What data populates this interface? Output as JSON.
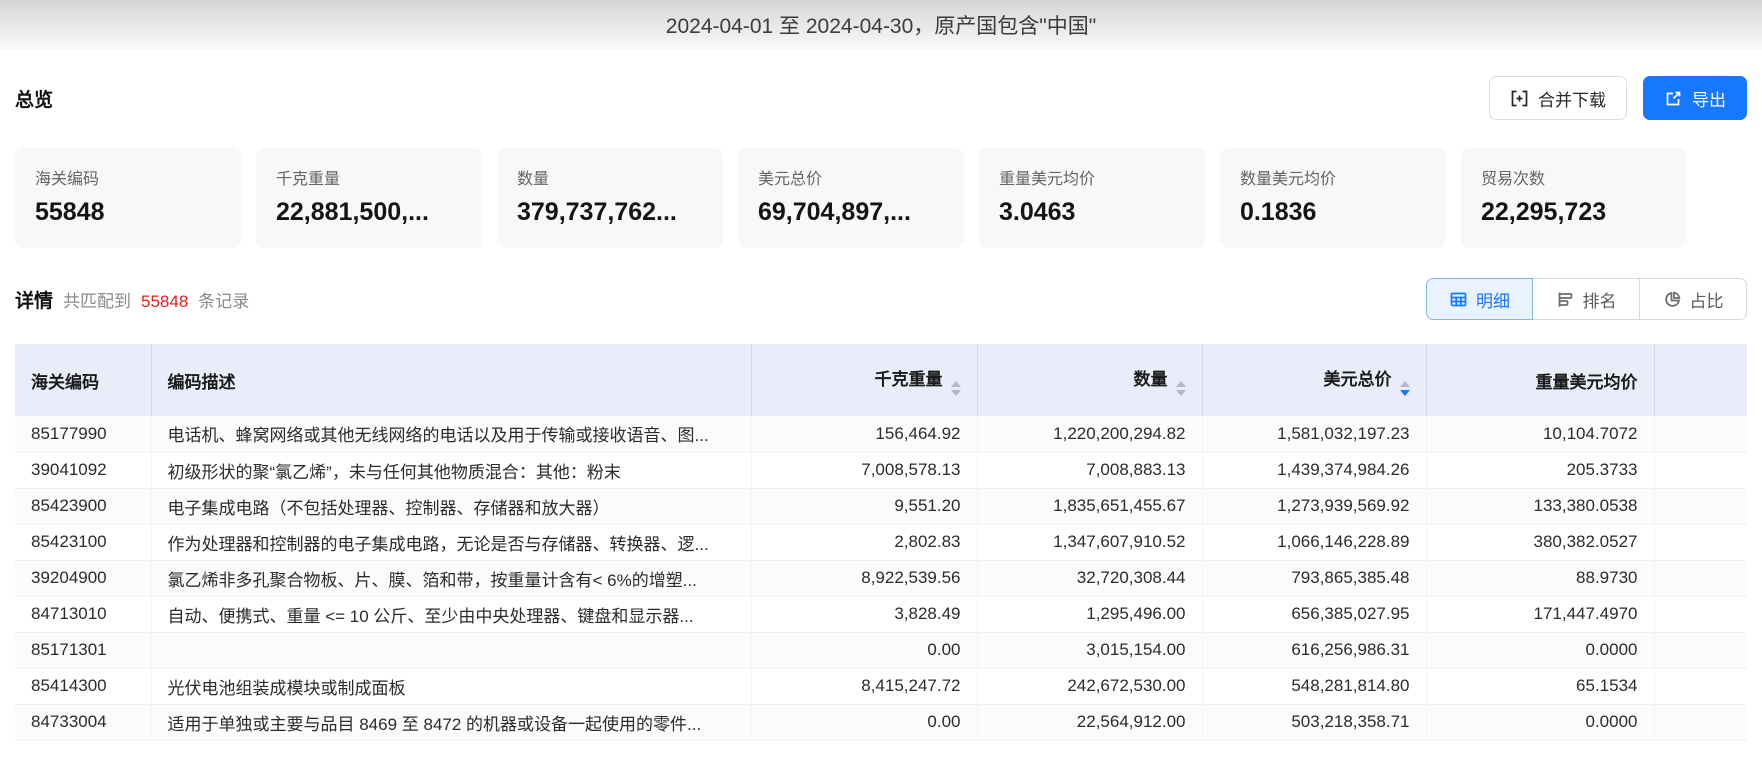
{
  "banner": {
    "title": "2024-04-01 至 2024-04-30，原产国包含\"中国\""
  },
  "overview": {
    "title": "总览",
    "merge_download_label": "合并下载",
    "export_label": "导出",
    "cards": [
      {
        "label": "海关编码",
        "value": "55848"
      },
      {
        "label": "千克重量",
        "value": "22,881,500,..."
      },
      {
        "label": "数量",
        "value": "379,737,762..."
      },
      {
        "label": "美元总价",
        "value": "69,704,897,..."
      },
      {
        "label": "重量美元均价",
        "value": "3.0463"
      },
      {
        "label": "数量美元均价",
        "value": "0.1836"
      },
      {
        "label": "贸易次数",
        "value": "22,295,723"
      }
    ]
  },
  "details": {
    "title": "详情",
    "match_prefix": "共匹配到",
    "record_count": "55848",
    "match_suffix": "条记录",
    "tabs": [
      {
        "label": "明细",
        "icon": "table-icon",
        "active": true
      },
      {
        "label": "排名",
        "icon": "ranking-icon",
        "active": false
      },
      {
        "label": "占比",
        "icon": "pie-icon",
        "active": false
      }
    ]
  },
  "table": {
    "columns": [
      {
        "label": "海关编码",
        "sortable": false,
        "sort": "none",
        "align": "left"
      },
      {
        "label": "编码描述",
        "sortable": false,
        "sort": "none",
        "align": "left"
      },
      {
        "label": "千克重量",
        "sortable": true,
        "sort": "none",
        "align": "right"
      },
      {
        "label": "数量",
        "sortable": true,
        "sort": "none",
        "align": "right"
      },
      {
        "label": "美元总价",
        "sortable": true,
        "sort": "desc",
        "align": "right"
      },
      {
        "label": "重量美元均价",
        "sortable": false,
        "sort": "none",
        "align": "right"
      }
    ],
    "rows": [
      [
        "85177990",
        "电话机、蜂窝网络或其他无线网络的电话以及用于传输或接收语音、图...",
        "156,464.92",
        "1,220,200,294.82",
        "1,581,032,197.23",
        "10,104.7072"
      ],
      [
        "39041092",
        "初级形状的聚“氯乙烯”，未与任何其他物质混合：其他：粉末",
        "7,008,578.13",
        "7,008,883.13",
        "1,439,374,984.26",
        "205.3733"
      ],
      [
        "85423900",
        "电子集成电路（不包括处理器、控制器、存储器和放大器）",
        "9,551.20",
        "1,835,651,455.67",
        "1,273,939,569.92",
        "133,380.0538"
      ],
      [
        "85423100",
        "作为处理器和控制器的电子集成电路，无论是否与存储器、转换器、逻...",
        "2,802.83",
        "1,347,607,910.52",
        "1,066,146,228.89",
        "380,382.0527"
      ],
      [
        "39204900",
        "氯乙烯非多孔聚合物板、片、膜、箔和带，按重量计含有< 6%的增塑...",
        "8,922,539.56",
        "32,720,308.44",
        "793,865,385.48",
        "88.9730"
      ],
      [
        "84713010",
        "自动、便携式、重量 <= 10 公斤、至少由中央处理器、键盘和显示器...",
        "3,828.49",
        "1,295,496.00",
        "656,385,027.95",
        "171,447.4970"
      ],
      [
        "85171301",
        "",
        "0.00",
        "3,015,154.00",
        "616,256,986.31",
        "0.0000"
      ],
      [
        "85414300",
        "光伏电池组装成模块或制成面板",
        "8,415,247.72",
        "242,672,530.00",
        "548,281,814.80",
        "65.1534"
      ],
      [
        "84733004",
        "适用于单独或主要与品目 8469 至 8472 的机器或设备一起使用的零件...",
        "0.00",
        "22,564,912.00",
        "503,218,358.71",
        "0.0000"
      ]
    ]
  },
  "colors": {
    "accent_blue": "#1677ff",
    "record_count_red": "#e02020",
    "table_header_bg": "#e9edf9",
    "card_bg": "#f7f8fa"
  }
}
